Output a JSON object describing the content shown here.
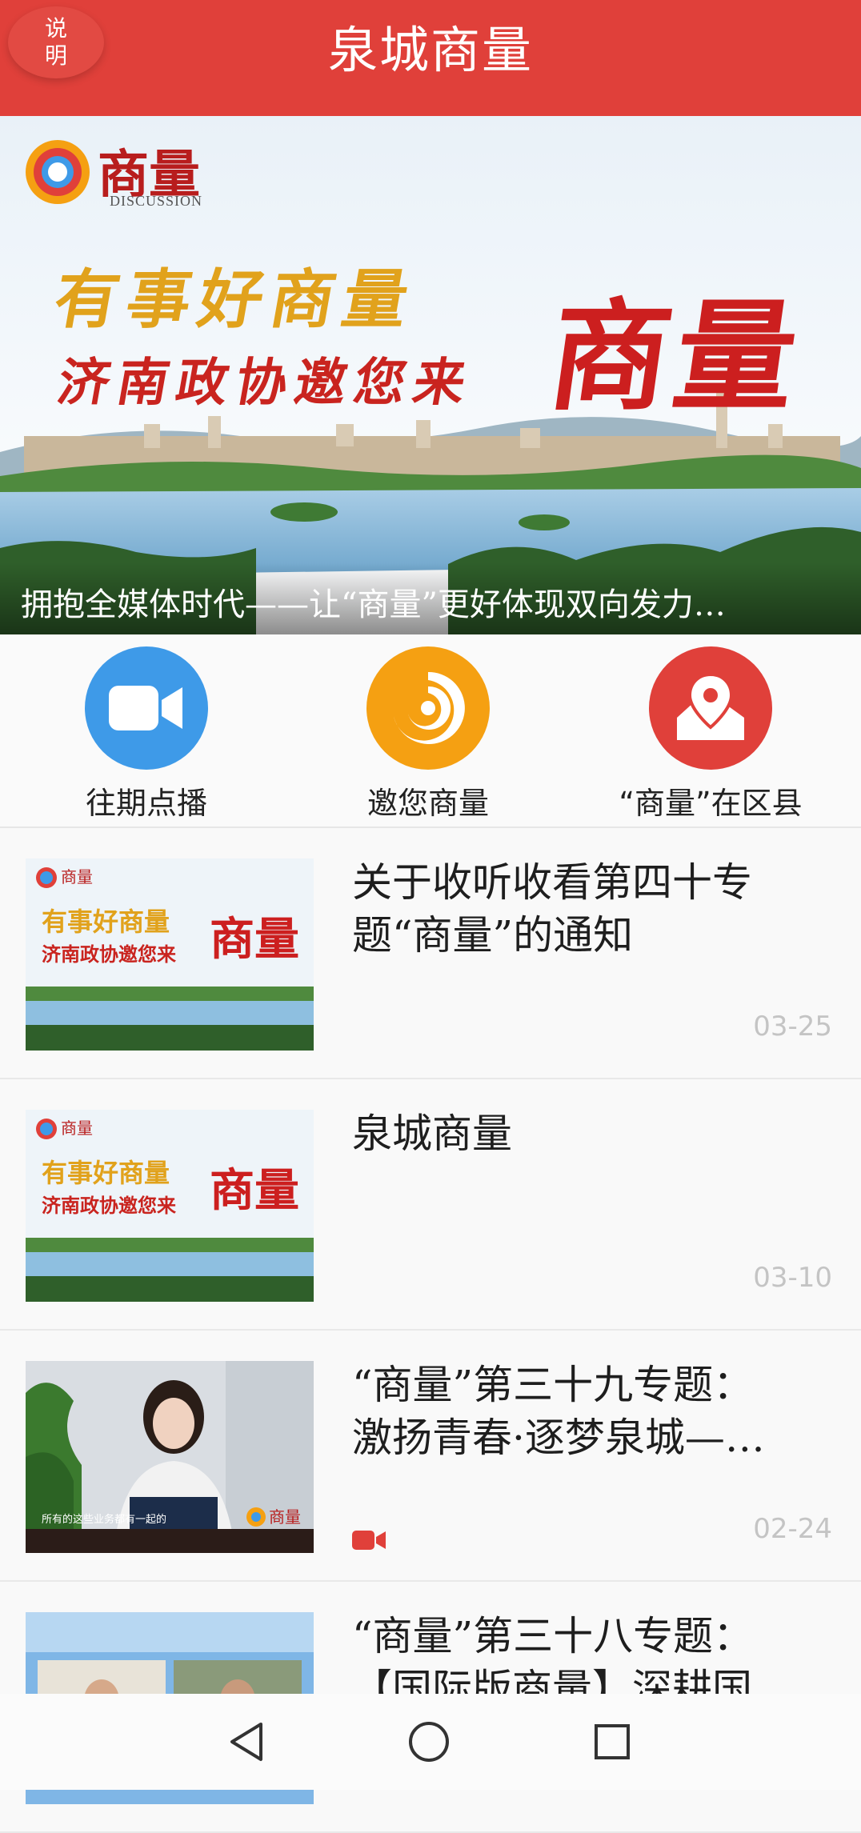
{
  "header": {
    "title": "泉城商量",
    "explain_label_top": "说",
    "explain_label_bottom": "明"
  },
  "banner": {
    "logo_text": "商量",
    "logo_sub": "DISCUSSION",
    "slogan_line1": "有事好商量",
    "slogan_line2": "济南政协邀您来",
    "slogan_big": "商量",
    "caption": "拥抱全媒体时代——让“商量”更好体现双向发力…"
  },
  "quick_nav": [
    {
      "label": "往期点播",
      "icon": "video-camera-icon",
      "color": "#3e9ae8"
    },
    {
      "label": "邀您商量",
      "icon": "swirl-logo-icon",
      "color": "#f5a012"
    },
    {
      "label": "“商量”在区县",
      "icon": "map-pin-icon",
      "color": "#e0403a"
    }
  ],
  "list": [
    {
      "title_line1": "关于收听收看第四十专",
      "title_line2": "题“商量”的通知",
      "date": "03-25",
      "thumb": "banner-art",
      "video": false
    },
    {
      "title_line1": "泉城商量",
      "title_line2": "",
      "date": "03-10",
      "thumb": "banner-art",
      "video": false
    },
    {
      "title_line1": "“商量”第三十九专题：",
      "title_line2": "激扬青春·逐梦泉城—…",
      "date": "02-24",
      "thumb": "speaker-photo",
      "video": true,
      "thumb_subtitle": "所有的这些业务都有一起的",
      "thumb_logo": "商量"
    },
    {
      "title_line1": "“商量”第三十八专题：",
      "title_line2": "【国际版商量】深耕国…",
      "date": "",
      "thumb": "video-call",
      "video": false
    }
  ],
  "colors": {
    "header_red": "#e0403a",
    "accent_blue": "#3e9ae8",
    "accent_orange": "#f5a012",
    "date_gray": "#c4c4c4"
  }
}
